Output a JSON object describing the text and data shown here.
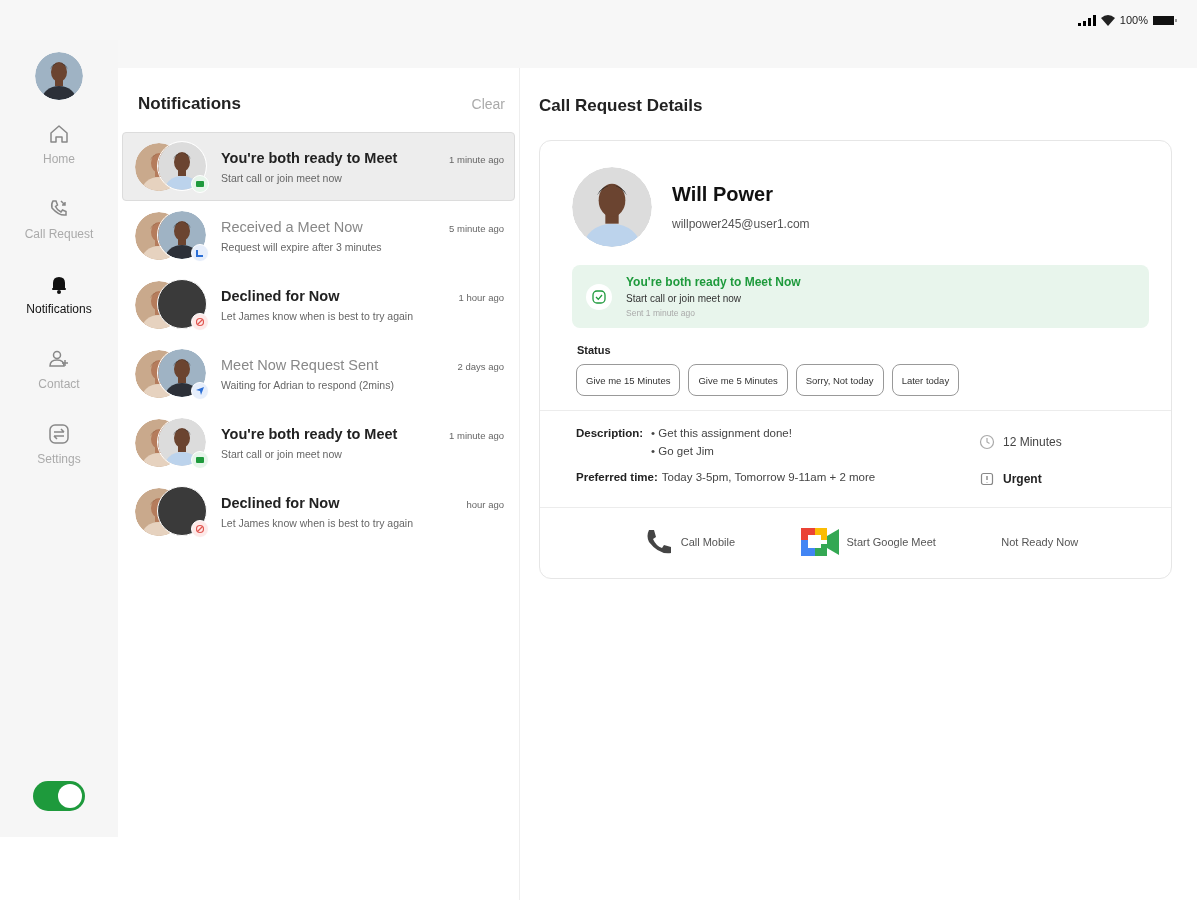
{
  "status_bar": {
    "battery": "100%"
  },
  "sidebar": {
    "items": [
      {
        "label": "Home",
        "selected": false
      },
      {
        "label": "Call Request",
        "selected": false
      },
      {
        "label": "Notifications",
        "selected": true
      },
      {
        "label": "Contact",
        "selected": false
      },
      {
        "label": "Settings",
        "selected": false
      }
    ],
    "toggle": {
      "on": true
    }
  },
  "notifications": {
    "title": "Notifications",
    "clear": "Clear",
    "items": [
      {
        "title": "You're both ready to Meet",
        "subtitle": "Start call or join meet now",
        "time": "1 minute ago",
        "kind": "meet",
        "unread": true,
        "selected": true
      },
      {
        "title": "Received a Meet Now",
        "subtitle": "Request will expire after 3 minutes",
        "time": "5 minute ago",
        "kind": "pending",
        "unread": false,
        "selected": false
      },
      {
        "title": "Declined for Now",
        "subtitle": "Let James know when is best to try again",
        "time": "1 hour ago",
        "kind": "declined",
        "unread": true,
        "selected": false
      },
      {
        "title": "Meet Now Request Sent",
        "subtitle": "Waiting for Adrian to respond (2mins)",
        "time": "2 days ago",
        "kind": "sent",
        "unread": false,
        "selected": false
      },
      {
        "title": "You're both ready to Meet",
        "subtitle": "Start call or join meet now",
        "time": "1 minute ago",
        "kind": "meet",
        "unread": true,
        "selected": false
      },
      {
        "title": "Declined for Now",
        "subtitle": "Let James know when is best to try again",
        "time": "hour ago",
        "kind": "declined",
        "unread": true,
        "selected": false
      }
    ]
  },
  "details": {
    "title": "Call Request Details",
    "name": "Will Power",
    "email": "willpower245@user1.com",
    "banner": {
      "title": "You're both ready to Meet Now",
      "subtitle": "Start call or join meet now",
      "sent": "Sent 1 minute ago"
    },
    "status": {
      "label": "Status",
      "options": [
        {
          "label": "Give me 15 Minutes",
          "selected": false
        },
        {
          "label": "Give me 5 Minutes",
          "selected": false
        },
        {
          "label": "Sorry, Not today",
          "selected": false
        },
        {
          "label": "Later today",
          "selected": false
        }
      ]
    },
    "description": {
      "label": "Description:",
      "items": [
        "• Get this assignment done!",
        "• Go get Jim"
      ]
    },
    "duration": "12 Minutes",
    "preferred": {
      "label": "Preferred time:",
      "value": "Today 3-5pm, Tomorrow 9-11am + 2 more"
    },
    "priority": "Urgent",
    "actions": [
      {
        "label": "Call Mobile",
        "kind": "phone"
      },
      {
        "label": "Start Google Meet",
        "kind": "meet"
      },
      {
        "label": "Not Ready Now",
        "kind": "text"
      }
    ]
  }
}
